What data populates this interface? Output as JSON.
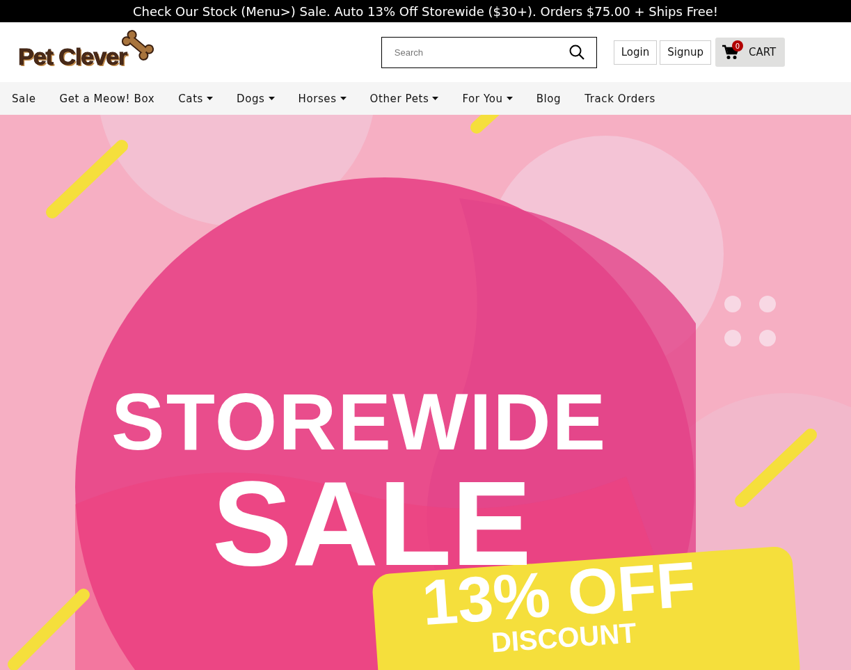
{
  "promo_bar": {
    "text": "Check Our Stock (Menu>) Sale. Auto 13% Off Storewide ($30+). Orders $75.00 + Ships Free!"
  },
  "header": {
    "logo": "Pet Clever",
    "search": {
      "placeholder": "Search"
    },
    "buttons": [
      "Login",
      "Signup"
    ],
    "cart": {
      "label": "CART",
      "count": "0"
    }
  },
  "nav": [
    {
      "label": "Sale",
      "dropdown": false
    },
    {
      "label": "Get a Meow! Box",
      "dropdown": false
    },
    {
      "label": "Cats",
      "dropdown": true
    },
    {
      "label": "Dogs",
      "dropdown": true
    },
    {
      "label": "Horses",
      "dropdown": true
    },
    {
      "label": "Other Pets",
      "dropdown": true
    },
    {
      "label": "For You",
      "dropdown": true
    },
    {
      "label": "Blog",
      "dropdown": false
    },
    {
      "label": "Track Orders",
      "dropdown": false
    }
  ],
  "hero": {
    "headline": "STOREWIDE",
    "subheadline": "SALE",
    "tag": "13% OFF",
    "tag_sub": "DISCOUNT"
  }
}
